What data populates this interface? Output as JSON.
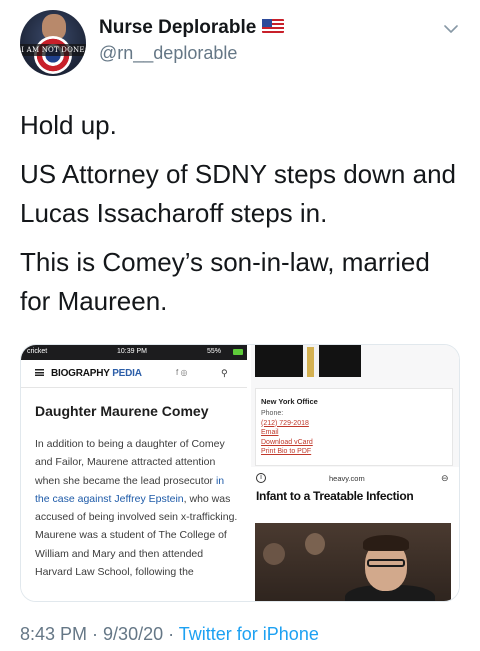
{
  "author": {
    "name": "Nurse Deplorable",
    "handle": "@rn__deplorable",
    "avatar_text": "I AM NOT DONE",
    "flag_icon": "us-flag-icon"
  },
  "tweet": {
    "paragraphs": [
      "Hold up.",
      "US Attorney of SDNY steps down and Lucas Issacharoff steps in.",
      "This is Comey’s son-in-law, married for Maureen."
    ]
  },
  "media": {
    "left": {
      "status_carrier": "cricket",
      "status_time": "10:39 PM",
      "status_battery": "55%",
      "site_name_a": "BIOGRAPHY",
      "site_name_b": "PEDIA",
      "social_icons": "f  ◎",
      "title": "Daughter Maurene Comey",
      "body_before_link": "In addition to being a daughter of Comey and Failor, Maurene attracted attention when she became the lead prosecutor ",
      "body_link": "in the case against Jeffrey Epstein",
      "body_after_link": ", who was accused of being involved sein x-trafficking. Maurene was a student of The College of William and Mary and then attended Harvard Law School, following the"
    },
    "right_top": {
      "office_title": "New York Office",
      "phone_label": "Phone:",
      "phone": "(212) 729-2018",
      "email": "Email",
      "vcard": "Download vCard",
      "print": "Print Bio to PDF"
    },
    "right_bottom": {
      "info_glyph": "i",
      "host": "heavy.com",
      "link_glyph": "⊖",
      "headline": "Infant to a Treatable Infection"
    }
  },
  "footer": {
    "time": "8:43 PM",
    "sep1": " · ",
    "date": "9/30/20",
    "sep2": " · ",
    "source": "Twitter for iPhone"
  },
  "colors": {
    "text": "#14171a",
    "secondary": "#657786",
    "link": "#1da1f2"
  }
}
